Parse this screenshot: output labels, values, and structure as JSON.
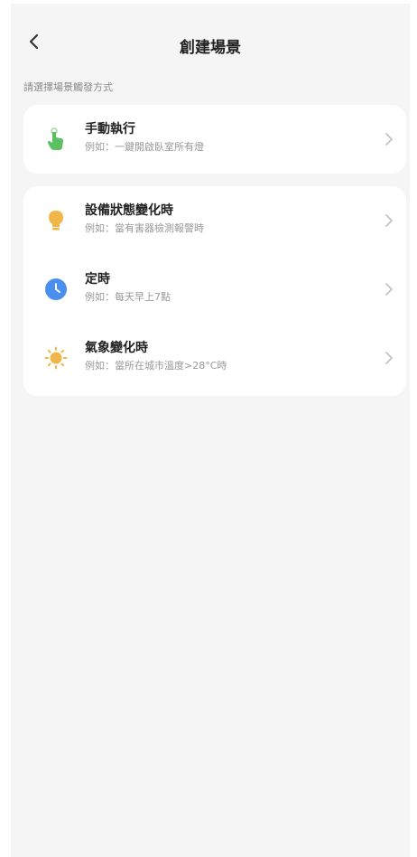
{
  "header": {
    "title": "創建場景"
  },
  "subtitle": "請選擇場景觸發方式",
  "triggers_card1": [
    {
      "label": "手動執行",
      "example": "例如：一鍵開啟臥室所有燈",
      "icon": "hand-tap-icon",
      "color": "#5cbf62"
    }
  ],
  "triggers_card2": [
    {
      "label": "設備狀態變化時",
      "example": "例如：當有害器檢測報警時",
      "icon": "lightbulb-icon",
      "color": "#f1b64a"
    },
    {
      "label": "定時",
      "example": "例如：每天早上7點",
      "icon": "clock-icon",
      "color": "#4a8ff0"
    },
    {
      "label": "氣象變化時",
      "example": "例如：當所在城市溫度>28°C時",
      "icon": "sun-icon",
      "color": "#f1b64a"
    }
  ]
}
